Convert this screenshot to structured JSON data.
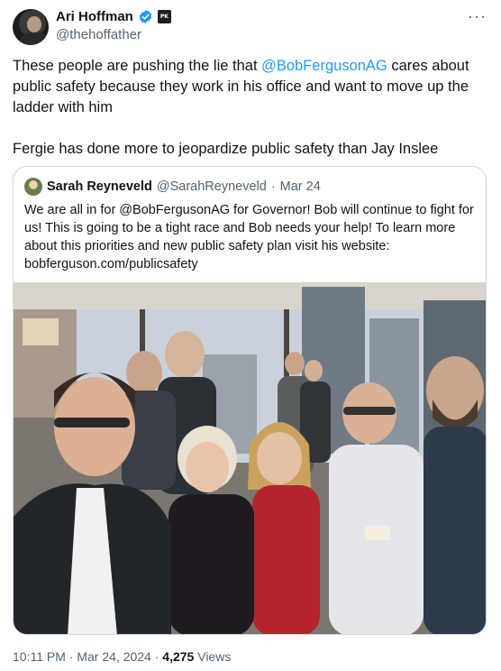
{
  "author": {
    "display_name": "Ari Hoffman",
    "handle": "@thehoffather",
    "affiliate_badge_text": "PK"
  },
  "tweet": {
    "line1_prefix": "These people are pushing the lie that ",
    "line1_mention": "@BobFergusonAG",
    "line1_suffix": " cares about public safety because they work in his office and want to move up the ladder with him",
    "line2": "Fergie has done more to jeopardize public safety than Jay Inslee"
  },
  "quoted": {
    "display_name": "Sarah Reyneveld",
    "handle": "@SarahReyneveld",
    "separator": "·",
    "date": "Mar 24",
    "text": "We are all in for @BobFergusonAG for Governor! Bob will continue to fight for us! This is going to be a tight race and Bob needs your help! To learn more about this priorities and new public safety plan visit his website: bobferguson.com/publicsafety"
  },
  "footer": {
    "time": "10:11 PM",
    "dot1": "·",
    "date": "Mar 24, 2024",
    "dot2": "·",
    "views_count": "4,275",
    "views_label": "Views"
  },
  "colors": {
    "link": "#1d9bf0",
    "secondary_text": "#536471",
    "border": "#cfd9de",
    "verified": "#1d9bf0"
  },
  "icons": [
    "verified-badge-icon",
    "affiliate-badge-icon",
    "more-options-icon"
  ]
}
